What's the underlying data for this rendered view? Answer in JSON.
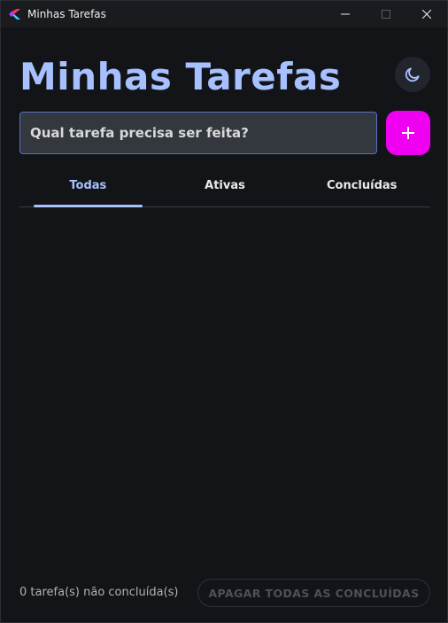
{
  "window": {
    "title": "Minhas Tarefas",
    "controls": [
      "minimize",
      "maximize",
      "close"
    ]
  },
  "header": {
    "title": "Minhas Tarefas",
    "theme_toggle_icon": "moon-icon"
  },
  "input": {
    "placeholder": "Qual tarefa precisa ser feita?",
    "value": "",
    "add_icon": "plus-icon"
  },
  "tabs": [
    {
      "label": "Todas",
      "active": true
    },
    {
      "label": "Ativas",
      "active": false
    },
    {
      "label": "Concluídas",
      "active": false
    }
  ],
  "tasks": [],
  "footer": {
    "count_text": "0 tarefa(s) não concluída(s)",
    "clear_label": "APAGAR TODAS AS CONCLUÍDAS"
  },
  "colors": {
    "accent": "#a7c0ff",
    "add_button": "#ef00f0",
    "background": "#121418"
  }
}
